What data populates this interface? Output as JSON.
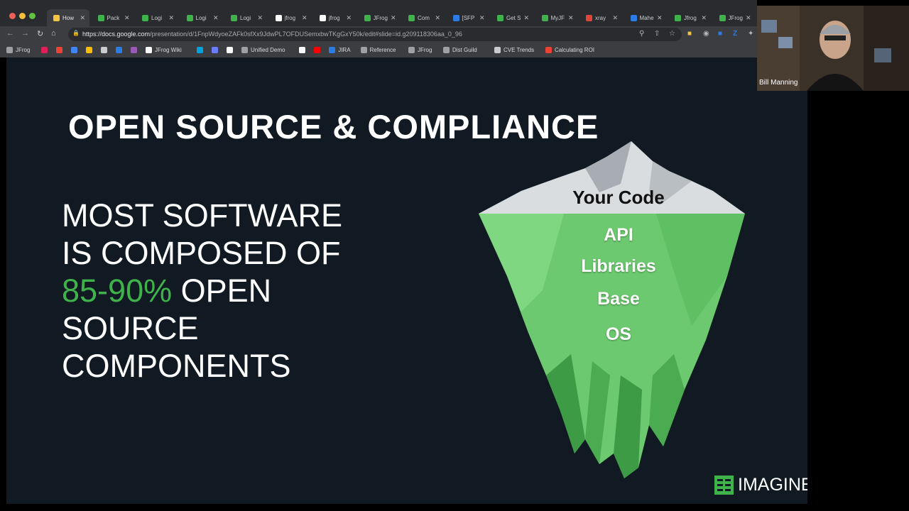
{
  "tabs": [
    {
      "label": "How",
      "active": true,
      "fav": "#f4c542"
    },
    {
      "label": "Pack",
      "fav": "#3fb24b"
    },
    {
      "label": "Logi",
      "fav": "#3fb24b"
    },
    {
      "label": "Logi",
      "fav": "#3fb24b"
    },
    {
      "label": "Logi",
      "fav": "#3fb24b"
    },
    {
      "label": "jfrog",
      "fav": "#ffffff"
    },
    {
      "label": "jfrog",
      "fav": "#ffffff"
    },
    {
      "label": "JFrog",
      "fav": "#3fb24b"
    },
    {
      "label": "Com",
      "fav": "#3fb24b"
    },
    {
      "label": "[SFP",
      "fav": "#2d7be5"
    },
    {
      "label": "Get S",
      "fav": "#3fb24b"
    },
    {
      "label": "MyJF",
      "fav": "#3fb24b"
    },
    {
      "label": "xray",
      "fav": "#e0453a"
    },
    {
      "label": "Mahe",
      "fav": "#2d7be5"
    },
    {
      "label": "Jfrog",
      "fav": "#3fb24b"
    },
    {
      "label": "JFrog",
      "fav": "#3fb24b"
    }
  ],
  "url": {
    "host": "https://docs.google.com",
    "path": "/presentation/d/1FnpWdyoeZAFk0sfXx9JdwPL7OFDUSemxbwTKgGxY50k/edit#slide=id.g209118306aa_0_96"
  },
  "bookmarks": [
    {
      "label": "JFrog",
      "icon": "folder-icon",
      "color": "#9da0a5"
    },
    {
      "label": "",
      "icon": "slack-icon",
      "color": "#e01e5a"
    },
    {
      "label": "",
      "icon": "gmail-icon",
      "color": "#ea4335"
    },
    {
      "label": "",
      "icon": "calendar-icon",
      "color": "#4285f4"
    },
    {
      "label": "",
      "icon": "drive-icon",
      "color": "#fbbc04"
    },
    {
      "label": "",
      "icon": "bookmark-icon",
      "color": "#c9cbd0"
    },
    {
      "label": "",
      "icon": "circle-icon",
      "color": "#2d7be5"
    },
    {
      "label": "",
      "icon": "app-icon",
      "color": "#9b59b6"
    },
    {
      "label": "JFrog Wiki",
      "icon": "wiki-icon",
      "color": "#ffffff"
    },
    {
      "label": "",
      "icon": "salesforce-icon",
      "color": "#00a1e0"
    },
    {
      "label": "",
      "icon": "app2-icon",
      "color": "#6b7cff"
    },
    {
      "label": "",
      "icon": "app3-icon",
      "color": "#ffffff"
    },
    {
      "label": "Unified Demo",
      "icon": "folder-icon",
      "color": "#9da0a5"
    },
    {
      "label": "",
      "icon": "github-icon",
      "color": "#ffffff"
    },
    {
      "label": "",
      "icon": "youtube-icon",
      "color": "#ff0000"
    },
    {
      "label": "JIRA",
      "icon": "jira-icon",
      "color": "#2d7be5"
    },
    {
      "label": "Reference",
      "icon": "folder-icon",
      "color": "#9da0a5"
    },
    {
      "label": "JFrog",
      "icon": "folder-icon",
      "color": "#9da0a5"
    },
    {
      "label": "Dist Guild",
      "icon": "folder-icon",
      "color": "#9da0a5"
    },
    {
      "label": "CVE Trends",
      "icon": "trend-icon",
      "color": "#c9cbd0"
    },
    {
      "label": "Calculating ROI",
      "icon": "roi-icon",
      "color": "#ea4335"
    }
  ],
  "slide": {
    "title": "OPEN SOURCE & COMPLIANCE",
    "line1": "MOST SOFTWARE",
    "line2": "IS COMPOSED OF",
    "percent": "85-90%",
    "line3": " OPEN",
    "line4": "SOURCE",
    "line5": "COMPONENTS",
    "iceberg": {
      "top": "Your Code",
      "layers": [
        "API",
        "Libraries",
        "Base",
        "OS"
      ]
    },
    "logo": "IMAGINE",
    "accent": "#3fb24b"
  },
  "video": {
    "participant": "Bill Manning"
  }
}
